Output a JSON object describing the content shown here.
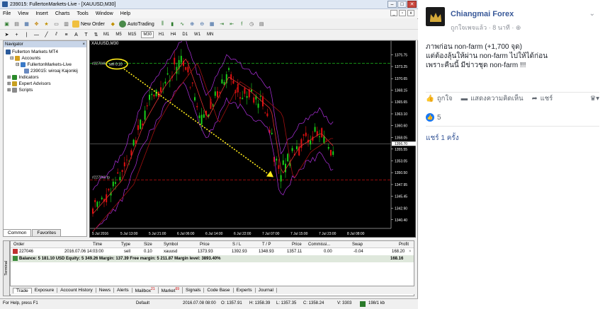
{
  "window": {
    "title": "239015: FullertonMarkets-Live - [XAUUSD,M30]"
  },
  "menu": [
    "File",
    "View",
    "Insert",
    "Charts",
    "Tools",
    "Window",
    "Help"
  ],
  "toolbar": {
    "new_order": "New Order",
    "auto_trading": "AutoTrading",
    "timeframes": [
      "M1",
      "M5",
      "M15",
      "M30",
      "H1",
      "H4",
      "D1",
      "W1",
      "MN"
    ],
    "active_tf": "M30"
  },
  "navigator": {
    "title": "Navigator",
    "items": [
      "Fullerton Markets MT4",
      "Accounts",
      "FullertonMarkets-Live",
      "239015: wiroaj Kajonkij",
      "Indicators",
      "Expert Advisors",
      "Scripts"
    ],
    "tabs": [
      "Common",
      "Favorites"
    ]
  },
  "chart": {
    "symbol": "XAUUSD,M30",
    "order_tag": "#227046",
    "sell_label": "sell 0.10",
    "price_labels": [
      "1375.75",
      "1373.25",
      "1370.65",
      "1368.15",
      "1365.65",
      "1363.10",
      "1360.60",
      "1358.05",
      "1355.55",
      "1353.05",
      "1350.50",
      "1347.95",
      "1345.45",
      "1342.90",
      "1340.40"
    ],
    "current_price": "1356.70",
    "time_labels": [
      "5 Jul 2016",
      "5 Jul 13:00",
      "5 Jul 21:00",
      "6 Jul 06:00",
      "6 Jul 14:00",
      "6 Jul 22:00",
      "7 Jul 07:00",
      "7 Jul 15:00",
      "7 Jul 23:00",
      "8 Jul 08:00"
    ]
  },
  "terminal": {
    "headers": [
      "Order",
      "Time",
      "Type",
      "Size",
      "Symbol",
      "Price",
      "S / L",
      "T / P",
      "Price",
      "Commissi...",
      "Swap",
      "Profit"
    ],
    "order": {
      "id": "227046",
      "time": "2016.07.06 14:03:00",
      "type": "sell",
      "size": "0.10",
      "symbol": "xauusd",
      "price": "1373.93",
      "sl": "1392.93",
      "tp": "1348.93",
      "cur": "1357.11",
      "comm": "0.00",
      "swap": "-0.04",
      "profit": "168.20"
    },
    "balance_line": "Balance: 5 181.10 USD  Equity: 5 349.26  Margin: 137.39  Free margin: 5 211.87  Margin level: 3893.40%",
    "balance_profit": "168.16",
    "tabs": [
      "Trade",
      "Exposure",
      "Account History",
      "News",
      "Alerts",
      "Mailbox",
      "Market",
      "Signals",
      "Code Base",
      "Experts",
      "Journal"
    ],
    "mailbox_badge": "21",
    "market_badge": "69",
    "side_label": "Terminal"
  },
  "status": {
    "help": "For Help, press F1",
    "profile": "Default",
    "time": "2016.07.08 08:00",
    "o": "O: 1357.91",
    "h": "H: 1358.39",
    "l": "L: 1357.35",
    "c": "C: 1358.24",
    "v": "V: 3303",
    "traffic": "198/1 kb"
  },
  "fb": {
    "page_name": "Chiangmai Forex",
    "meta": "ถูกใจเพจแล้ว · 8 นาที · ",
    "lines": [
      "ภาพก่อน non-farm (+1,700 จุด)",
      "แต่ต้องลุ้นให้ผ่าน non-farm ไปให้ได้ก่อน",
      "เพราะคืนนี้ มีข่าวชุด non-farm !!!"
    ],
    "like": "ถูกใจ",
    "comment": "แสดงความคิดเห็น",
    "share": "แชร์",
    "like_count": "5",
    "shares": "แชร์ 1 ครั้ง"
  }
}
